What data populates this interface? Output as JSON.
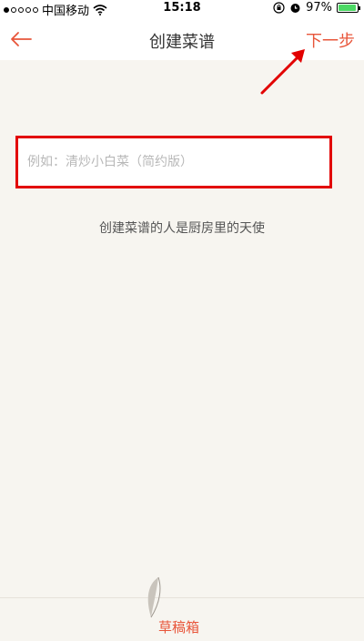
{
  "status_bar": {
    "carrier": "中国移动",
    "time": "15:18",
    "battery": "97%",
    "battery_level": 0.97,
    "icons": [
      "signal-dots-icon",
      "wifi-icon",
      "orientation-lock-icon",
      "alarm-icon",
      "battery-icon"
    ]
  },
  "nav": {
    "title": "创建菜谱",
    "back_icon": "arrow-left-icon",
    "next_label": "下一步"
  },
  "form": {
    "name_placeholder": "例如：清炒小白菜（简约版）",
    "name_value": ""
  },
  "slogan": "创建菜谱的人是厨房里的天使",
  "bottom": {
    "draft_label": "草稿箱",
    "draft_icon": "feather-icon"
  },
  "colors": {
    "accent": "#e8553a",
    "highlight_box": "#e20000",
    "background": "#f7f5f0"
  }
}
